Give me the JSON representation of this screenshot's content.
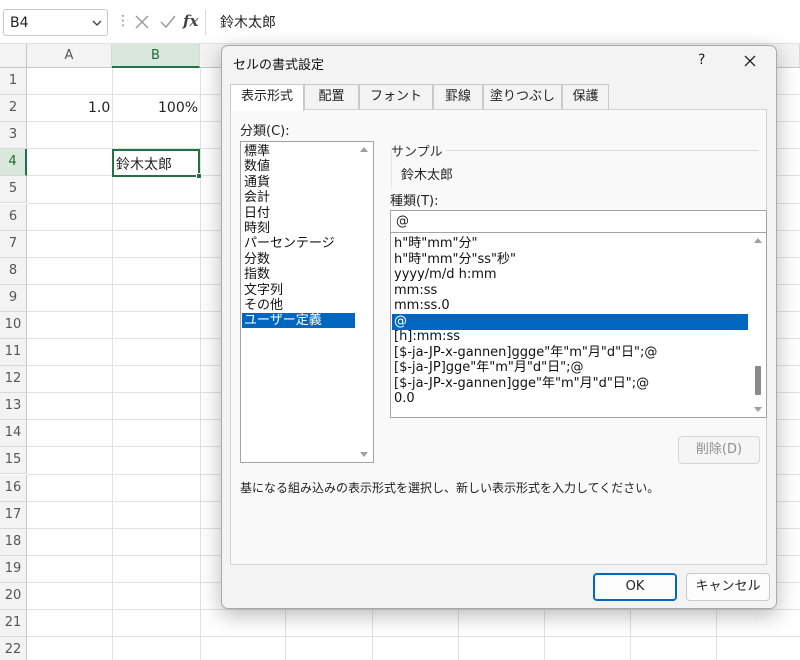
{
  "formula_bar": {
    "name_box": "B4",
    "formula": "鈴木太郎",
    "fx_label": "fx"
  },
  "sheet": {
    "columns": [
      "A",
      "B"
    ],
    "rows": [
      "1",
      "2",
      "3",
      "4",
      "5",
      "6",
      "7",
      "8",
      "9",
      "10",
      "11",
      "12",
      "13",
      "14",
      "15",
      "16",
      "17",
      "18",
      "19",
      "20",
      "21",
      "22"
    ],
    "cells": {
      "A2": "1.0",
      "B2": "100%",
      "B4": "鈴木太郎"
    }
  },
  "dialog": {
    "title": "セルの書式設定",
    "help": "?",
    "tabs": [
      "表示形式",
      "配置",
      "フォント",
      "罫線",
      "塗りつぶし",
      "保護"
    ],
    "category_label": "分類(C):",
    "categories": [
      "標準",
      "数値",
      "通貨",
      "会計",
      "日付",
      "時刻",
      "パーセンテージ",
      "分数",
      "指数",
      "文字列",
      "その他",
      "ユーザー定義"
    ],
    "selected_category": "ユーザー定義",
    "sample_label": "サンプル",
    "sample_value": "鈴木太郎",
    "type_label": "種類(T):",
    "type_value": "@",
    "formats": [
      "h\"時\"mm\"分\"",
      "h\"時\"mm\"分\"ss\"秒\"",
      "yyyy/m/d h:mm",
      "mm:ss",
      "mm:ss.0",
      "@",
      "[h]:mm:ss",
      "[$-ja-JP-x-gannen]ggge\"年\"m\"月\"d\"日\";@",
      "[$-ja-JP]gge\"年\"m\"月\"d\"日\";@",
      "[$-ja-JP-x-gannen]gge\"年\"m\"月\"d\"日\";@",
      "0.0"
    ],
    "selected_format": "@",
    "delete_button": "削除(D)",
    "description": "基になる組み込みの表示形式を選択し、新しい表示形式を入力してください。",
    "ok_button": "OK",
    "cancel_button": "キャンセル"
  },
  "colors": {
    "accent_green": "#217346",
    "selection_blue": "#0067c0"
  }
}
